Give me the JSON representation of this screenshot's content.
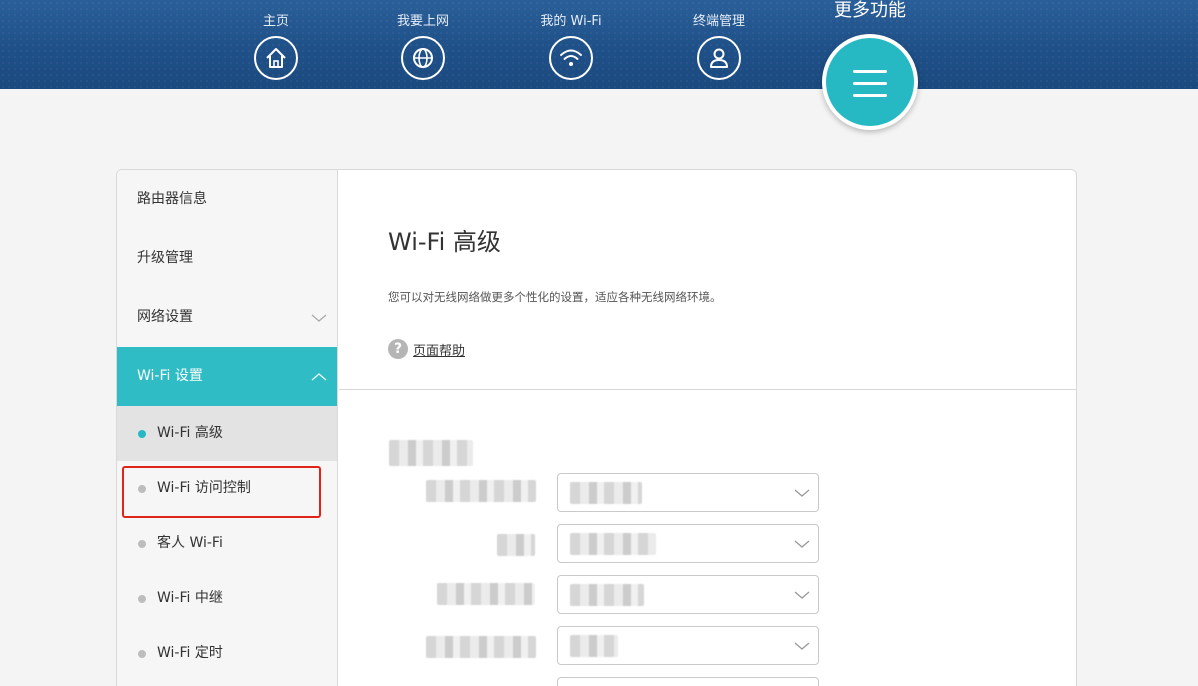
{
  "nav": {
    "items": [
      {
        "label": "主页",
        "icon": "home-icon"
      },
      {
        "label": "我要上网",
        "icon": "globe-icon"
      },
      {
        "label": "我的 Wi-Fi",
        "icon": "wifi-icon"
      },
      {
        "label": "终端管理",
        "icon": "user-icon"
      }
    ],
    "more_label": "更多功能",
    "more_icon": "menu-icon"
  },
  "sidebar": {
    "items": [
      {
        "label": "路由器信息"
      },
      {
        "label": "升级管理"
      },
      {
        "label": "网络设置"
      },
      {
        "label": "Wi-Fi 设置"
      }
    ],
    "subitems": [
      {
        "label": "Wi-Fi 高级"
      },
      {
        "label": "Wi-Fi 访问控制"
      },
      {
        "label": "客人 Wi-Fi"
      },
      {
        "label": "Wi-Fi 中继"
      },
      {
        "label": "Wi-Fi 定时"
      }
    ]
  },
  "main": {
    "title": "Wi-Fi 高级",
    "description": "您可以对无线网络做更多个性化的设置，适应各种无线网络环境。",
    "help_icon": "?",
    "help_label": "页面帮助"
  },
  "colors": {
    "header": "#1f5088",
    "accent": "#2fbcc4",
    "highlight_border": "#e2231a"
  }
}
